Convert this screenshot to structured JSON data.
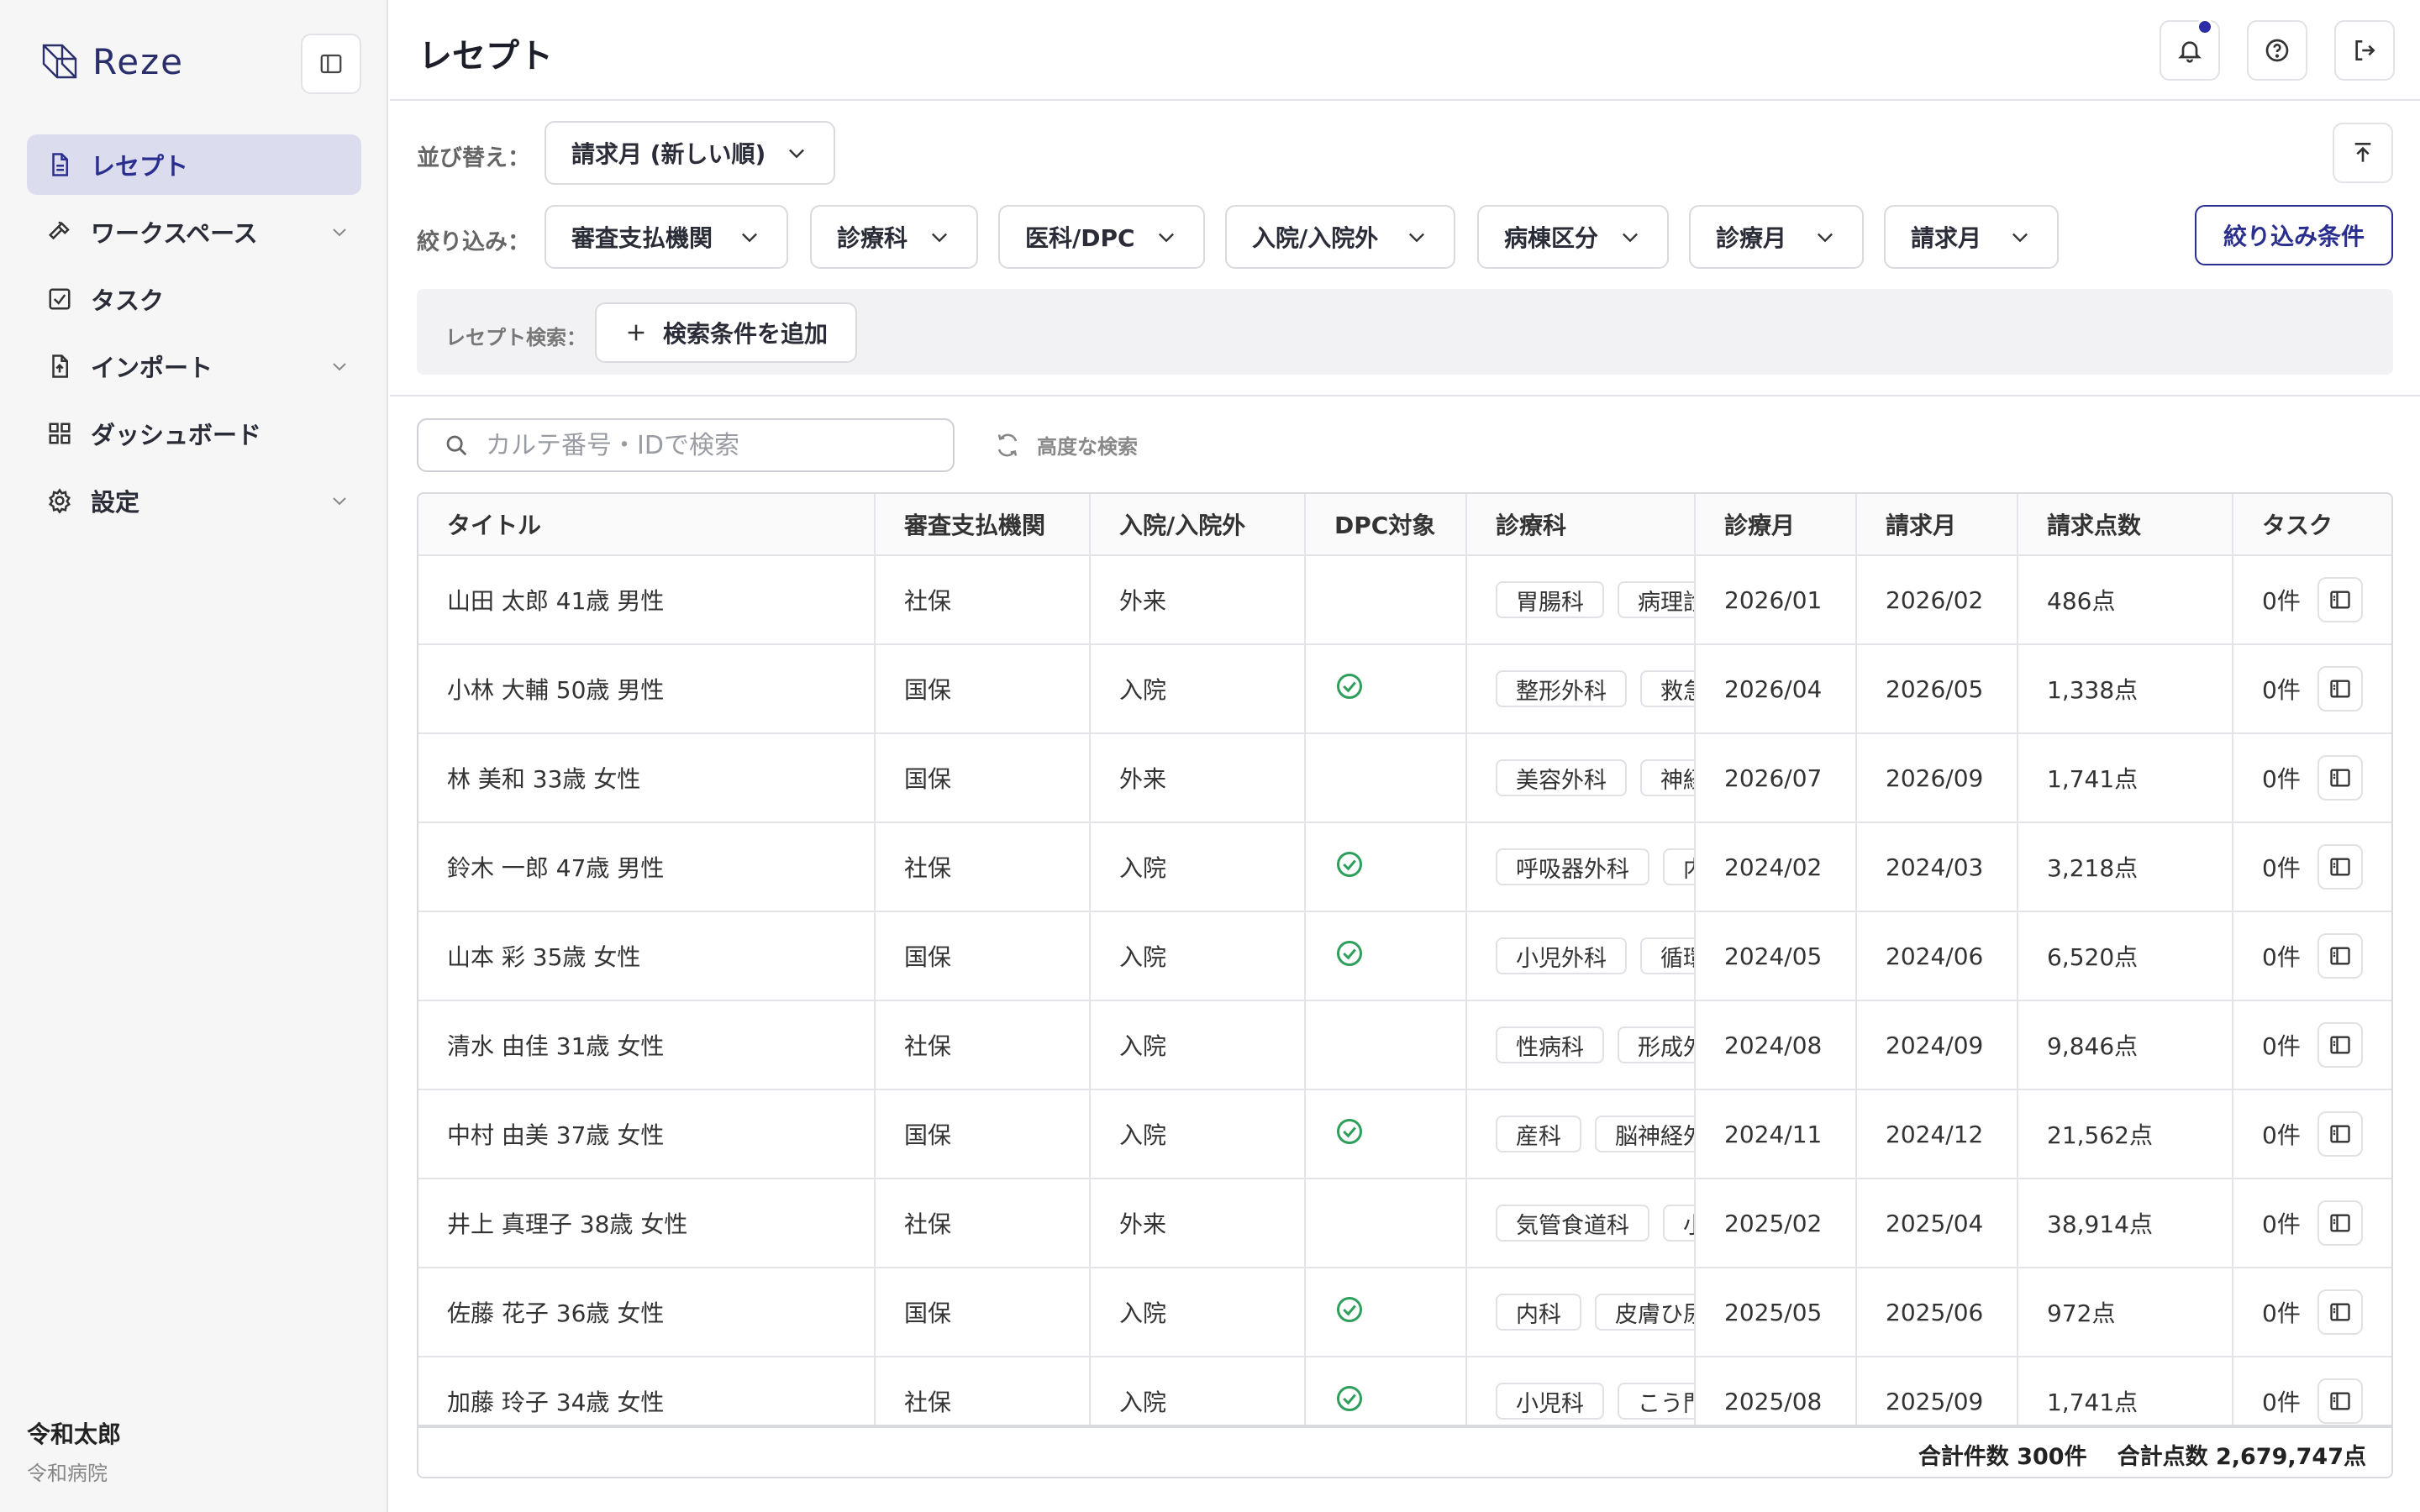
{
  "app": {
    "name": "Reze"
  },
  "sidebar": {
    "items": [
      {
        "label": "レセプト",
        "icon": "document-icon",
        "active": true
      },
      {
        "label": "ワークスペース",
        "icon": "hammer-icon",
        "expandable": true
      },
      {
        "label": "タスク",
        "icon": "checkbox-icon"
      },
      {
        "label": "インポート",
        "icon": "file-upload-icon",
        "expandable": true
      },
      {
        "label": "ダッシュボード",
        "icon": "grid-icon"
      },
      {
        "label": "設定",
        "icon": "gear-icon",
        "expandable": true
      }
    ],
    "user": {
      "name": "令和太郎",
      "org": "令和病院"
    }
  },
  "header": {
    "title": "レセプト"
  },
  "sort": {
    "label": "並び替え：",
    "value": "請求月 (新しい順)"
  },
  "filter": {
    "label": "絞り込み：",
    "dropdowns": [
      "審査支払機関",
      "診療科",
      "医科/DPC",
      "入院/入院外",
      "病棟区分",
      "診療月",
      "請求月"
    ],
    "conditions_button": "絞り込み条件"
  },
  "receipt_search": {
    "label": "レセプト検索：",
    "add_button": "検索条件を追加"
  },
  "search": {
    "placeholder": "カルテ番号・IDで検索",
    "advanced": "高度な検索"
  },
  "table": {
    "columns": [
      "タイトル",
      "審査支払機関",
      "入院/入院外",
      "DPC対象",
      "診療科",
      "診療月",
      "請求月",
      "請求点数",
      "タスク"
    ],
    "rows": [
      {
        "title": "山田 太郎  41歳  男性",
        "payer": "社保",
        "inout": "外来",
        "dpc": false,
        "depts": [
          "胃腸科",
          "病理診断科"
        ],
        "month": "2026/01",
        "bill": "2026/02",
        "points": "486点",
        "tasks": "0件"
      },
      {
        "title": "小林 大輔  50歳  男性",
        "payer": "国保",
        "inout": "入院",
        "dpc": true,
        "depts": [
          "整形外科",
          "救急科"
        ],
        "month": "2026/04",
        "bill": "2026/05",
        "points": "1,338点",
        "tasks": "0件"
      },
      {
        "title": "林 美和  33歳  女性",
        "payer": "国保",
        "inout": "外来",
        "dpc": false,
        "depts": [
          "美容外科",
          "神経内科"
        ],
        "month": "2026/07",
        "bill": "2026/09",
        "points": "1,741点",
        "tasks": "0件"
      },
      {
        "title": "鈴木 一郎  47歳  男性",
        "payer": "社保",
        "inout": "入院",
        "dpc": true,
        "depts": [
          "呼吸器外科",
          "内科"
        ],
        "month": "2024/02",
        "bill": "2024/03",
        "points": "3,218点",
        "tasks": "0件"
      },
      {
        "title": "山本 彩  35歳  女性",
        "payer": "国保",
        "inout": "入院",
        "dpc": true,
        "depts": [
          "小児外科",
          "循環器科"
        ],
        "month": "2024/05",
        "bill": "2024/06",
        "points": "6,520点",
        "tasks": "0件"
      },
      {
        "title": "清水 由佳  31歳  女性",
        "payer": "社保",
        "inout": "入院",
        "dpc": false,
        "depts": [
          "性病科",
          "形成外科"
        ],
        "month": "2024/08",
        "bill": "2024/09",
        "points": "9,846点",
        "tasks": "0件"
      },
      {
        "title": "中村 由美  37歳  女性",
        "payer": "国保",
        "inout": "入院",
        "dpc": true,
        "depts": [
          "産科",
          "脳神経外科"
        ],
        "month": "2024/11",
        "bill": "2024/12",
        "points": "21,562点",
        "tasks": "0件"
      },
      {
        "title": "井上 真理子  38歳  女性",
        "payer": "社保",
        "inout": "外来",
        "dpc": false,
        "depts": [
          "気管食道科",
          "小児科"
        ],
        "month": "2025/02",
        "bill": "2025/04",
        "points": "38,914点",
        "tasks": "0件"
      },
      {
        "title": "佐藤 花子  36歳  女性",
        "payer": "国保",
        "inout": "入院",
        "dpc": true,
        "depts": [
          "内科",
          "皮膚ひ尿器科"
        ],
        "month": "2025/05",
        "bill": "2025/06",
        "points": "972点",
        "tasks": "0件"
      },
      {
        "title": "加藤 玲子  34歳  女性",
        "payer": "社保",
        "inout": "入院",
        "dpc": true,
        "depts": [
          "小児科",
          "こう門科"
        ],
        "month": "2025/08",
        "bill": "2025/09",
        "points": "1,741点",
        "tasks": "0件"
      }
    ],
    "footer": {
      "count": "合計件数 300件",
      "points": "合計点数 2,679,747点"
    }
  },
  "colors": {
    "accent": "#2a2f8f",
    "active_bg": "#dcdcef",
    "check": "#2e9e5b",
    "notif": "#2b2fa5"
  }
}
